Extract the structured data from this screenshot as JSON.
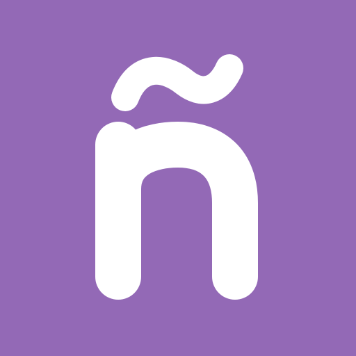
{
  "icon": {
    "glyph": "ñ",
    "background_color": "#9369b6",
    "glyph_color": "#ffffff",
    "icon_name": "n-tilde-icon"
  }
}
